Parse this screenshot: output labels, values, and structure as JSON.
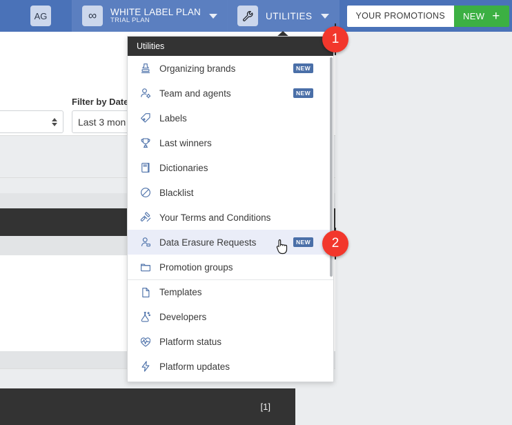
{
  "header": {
    "user_avatar": "AG",
    "brand_icon": "infinity-icon",
    "plan_name": "WHITE LABEL PLAN",
    "plan_sub": "TRIAL PLAN",
    "utilities_icon": "wrench-icon",
    "utilities_label": "UTILITIES",
    "promotions_label": "YOUR PROMOTIONS",
    "new_label": "NEW",
    "new_plus": "+",
    "bg_color": "#4a72b8",
    "new_btn_color": "#3cb043"
  },
  "page": {
    "filter_label": "Filter by Date",
    "date_select_value": "Last 3 mon",
    "other_select_value": ""
  },
  "menu": {
    "title": "Utilities",
    "badge_text": "NEW",
    "items": [
      {
        "label": "Organizing brands",
        "icon": "stamp-icon",
        "badge": "NEW",
        "selected": false,
        "divider": false
      },
      {
        "label": "Team and agents",
        "icon": "user-gear-icon",
        "badge": "NEW",
        "selected": false,
        "divider": false
      },
      {
        "label": "Labels",
        "icon": "tag-icon",
        "badge": "",
        "selected": false,
        "divider": false
      },
      {
        "label": "Last winners",
        "icon": "trophy-icon",
        "badge": "",
        "selected": false,
        "divider": false
      },
      {
        "label": "Dictionaries",
        "icon": "book-icon",
        "badge": "",
        "selected": false,
        "divider": false
      },
      {
        "label": "Blacklist",
        "icon": "ban-icon",
        "badge": "",
        "selected": false,
        "divider": false
      },
      {
        "label": "Your Terms and Conditions",
        "icon": "gavel-icon",
        "badge": "",
        "selected": false,
        "divider": false
      },
      {
        "label": "Data Erasure Requests",
        "icon": "user-card-icon",
        "badge": "NEW",
        "selected": true,
        "divider": false
      },
      {
        "label": "Promotion groups",
        "icon": "folder-icon",
        "badge": "",
        "selected": false,
        "divider": false
      },
      {
        "label": "Templates",
        "icon": "file-icon",
        "badge": "",
        "selected": false,
        "divider": true
      },
      {
        "label": "Developers",
        "icon": "flask-icon",
        "badge": "",
        "selected": false,
        "divider": false
      },
      {
        "label": "Platform status",
        "icon": "heartbeat-icon",
        "badge": "",
        "selected": false,
        "divider": false
      },
      {
        "label": "Platform updates",
        "icon": "bolt-icon",
        "badge": "",
        "selected": false,
        "divider": false
      }
    ]
  },
  "markers": [
    {
      "number": "1",
      "color": "#f2372c"
    },
    {
      "number": "2",
      "color": "#f2372c"
    }
  ],
  "footer": {
    "page_indicator": "[1]"
  }
}
